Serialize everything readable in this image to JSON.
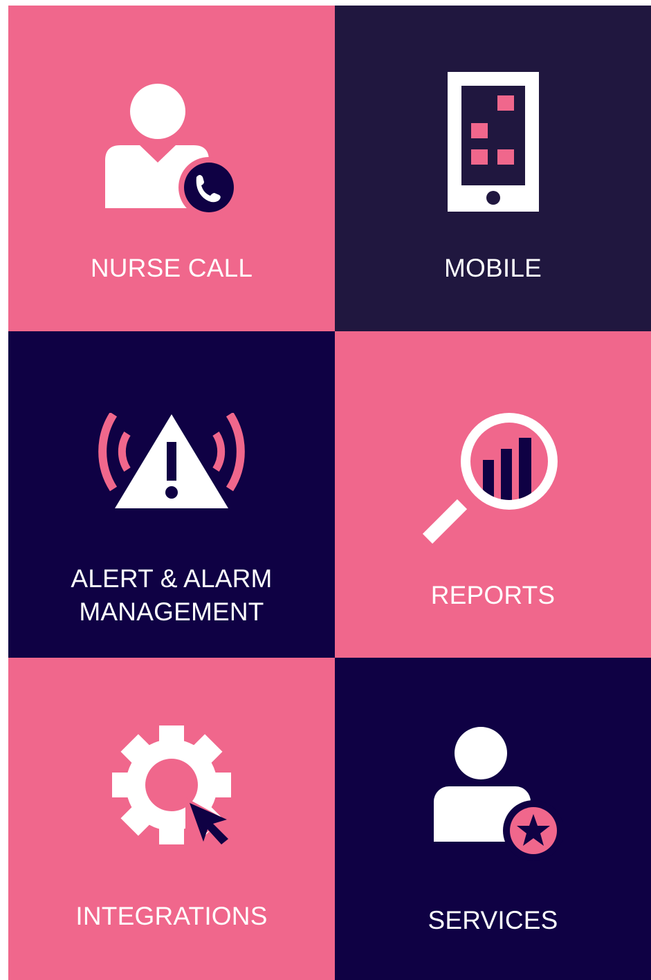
{
  "colors": {
    "pink": "#f0678c",
    "navy_mobile": "#20173f",
    "navy": "#0f0144",
    "white": "#ffffff"
  },
  "tiles": [
    {
      "label": "NURSE CALL",
      "icon": "nurse-phone-icon"
    },
    {
      "label": "MOBILE",
      "icon": "mobile-phone-icon"
    },
    {
      "label": "ALERT & ALARM",
      "label2": "MANAGEMENT",
      "icon": "alarm-warning-icon"
    },
    {
      "label": "REPORTS",
      "icon": "magnifier-chart-icon"
    },
    {
      "label": "INTEGRATIONS",
      "icon": "gear-cursor-icon"
    },
    {
      "label": "SERVICES",
      "icon": "person-star-icon"
    }
  ]
}
